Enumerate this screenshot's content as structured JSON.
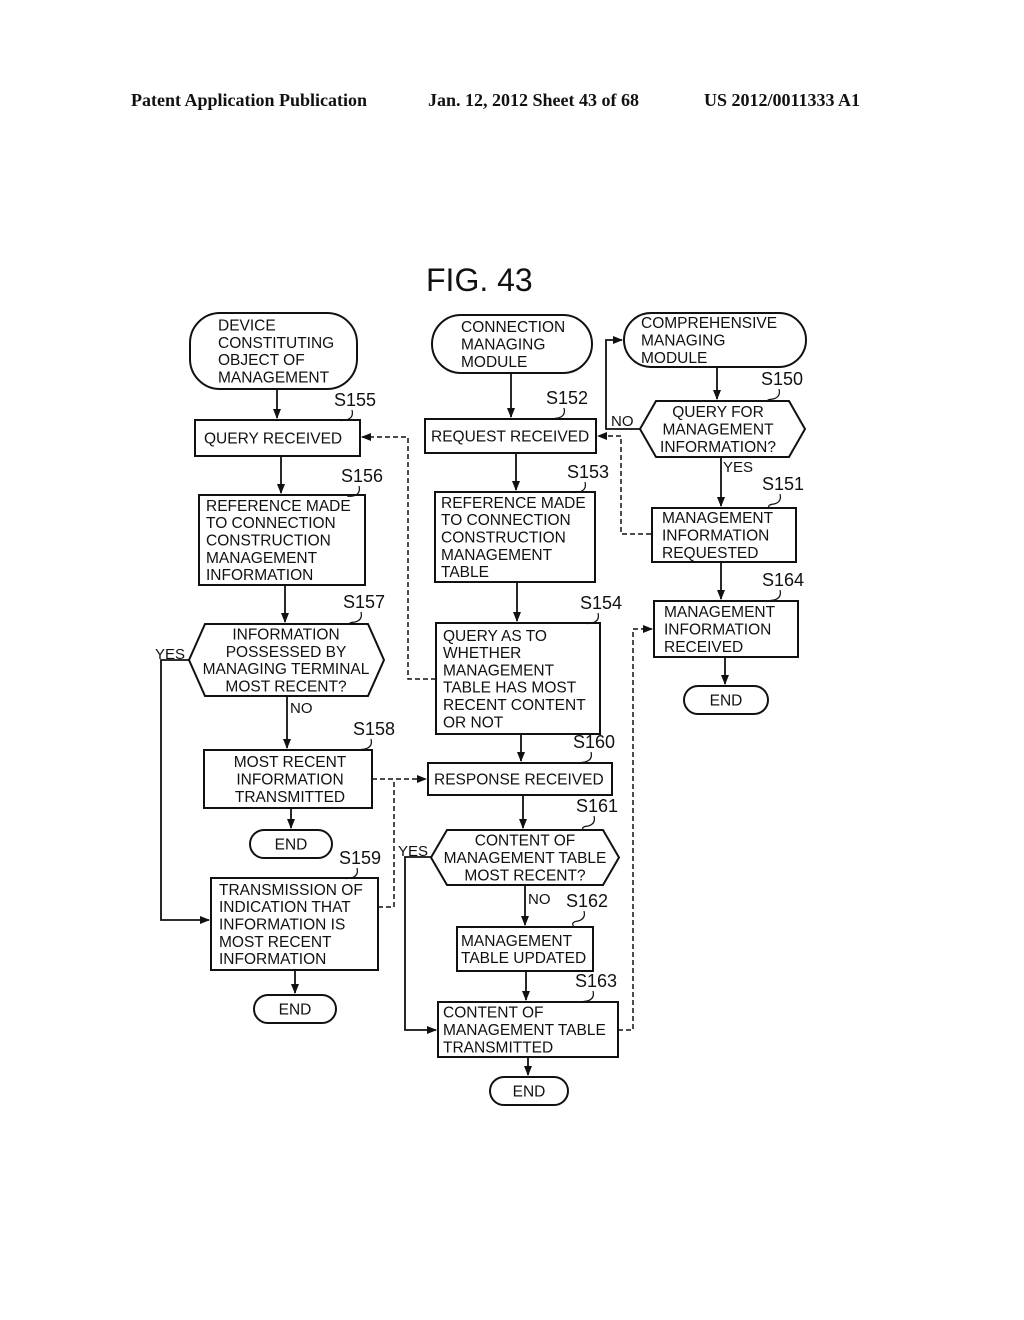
{
  "header": {
    "publication": "Patent Application Publication",
    "date_sheet": "Jan. 12, 2012  Sheet 43 of 68",
    "number": "US 2012/0011333 A1"
  },
  "figure": {
    "title": "FIG. 43",
    "nodes": {
      "device_start": {
        "lines": [
          "DEVICE",
          "CONSTITUTING",
          "OBJECT OF",
          "MANAGEMENT"
        ]
      },
      "conn_start": {
        "lines": [
          "CONNECTION",
          "MANAGING",
          "MODULE"
        ]
      },
      "comp_start": {
        "lines": [
          "COMPREHENSIVE",
          "MANAGING",
          "MODULE"
        ]
      },
      "s150": {
        "step": "S150",
        "lines": [
          "QUERY FOR",
          "MANAGEMENT",
          "INFORMATION?"
        ]
      },
      "s151": {
        "step": "S151",
        "lines": [
          "MANAGEMENT",
          "INFORMATION",
          "REQUESTED"
        ]
      },
      "s152": {
        "step": "S152",
        "lines": [
          "REQUEST RECEIVED"
        ]
      },
      "s153": {
        "step": "S153",
        "lines": [
          "REFERENCE MADE",
          "TO CONNECTION",
          "CONSTRUCTION",
          "MANAGEMENT",
          "TABLE"
        ]
      },
      "s154": {
        "step": "S154",
        "lines": [
          "QUERY AS TO",
          "WHETHER",
          "MANAGEMENT",
          "TABLE HAS MOST",
          "RECENT CONTENT",
          "OR NOT"
        ]
      },
      "s155": {
        "step": "S155",
        "lines": [
          "QUERY RECEIVED"
        ]
      },
      "s156": {
        "step": "S156",
        "lines": [
          "REFERENCE MADE",
          "TO CONNECTION",
          "CONSTRUCTION",
          "MANAGEMENT",
          "INFORMATION"
        ]
      },
      "s157": {
        "step": "S157",
        "lines": [
          "INFORMATION",
          "POSSESSED BY",
          "MANAGING TERMINAL",
          "MOST RECENT?"
        ]
      },
      "s158": {
        "step": "S158",
        "lines": [
          "MOST RECENT",
          "INFORMATION",
          "TRANSMITTED"
        ]
      },
      "s159": {
        "step": "S159",
        "lines": [
          "TRANSMISSION OF",
          "INDICATION THAT",
          "INFORMATION IS",
          "MOST RECENT",
          "INFORMATION"
        ]
      },
      "s160": {
        "step": "S160",
        "lines": [
          "RESPONSE RECEIVED"
        ]
      },
      "s161": {
        "step": "S161",
        "lines": [
          "CONTENT OF",
          "MANAGEMENT TABLE",
          "MOST RECENT?"
        ]
      },
      "s162": {
        "step": "S162",
        "lines": [
          "MANAGEMENT",
          "TABLE UPDATED"
        ]
      },
      "s163": {
        "step": "S163",
        "lines": [
          "CONTENT OF",
          "MANAGEMENT TABLE",
          "TRANSMITTED"
        ]
      },
      "s164": {
        "step": "S164",
        "lines": [
          "MANAGEMENT",
          "INFORMATION",
          "RECEIVED"
        ]
      },
      "end_a": {
        "lines": [
          "END"
        ]
      },
      "end_b": {
        "lines": [
          "END"
        ]
      },
      "end_c": {
        "lines": [
          "END"
        ]
      },
      "end_d": {
        "lines": [
          "END"
        ]
      }
    },
    "branch_labels": {
      "s150_no": "NO",
      "s150_yes": "YES",
      "s157_yes": "YES",
      "s157_no": "NO",
      "s161_yes": "YES",
      "s161_no": "NO"
    }
  }
}
